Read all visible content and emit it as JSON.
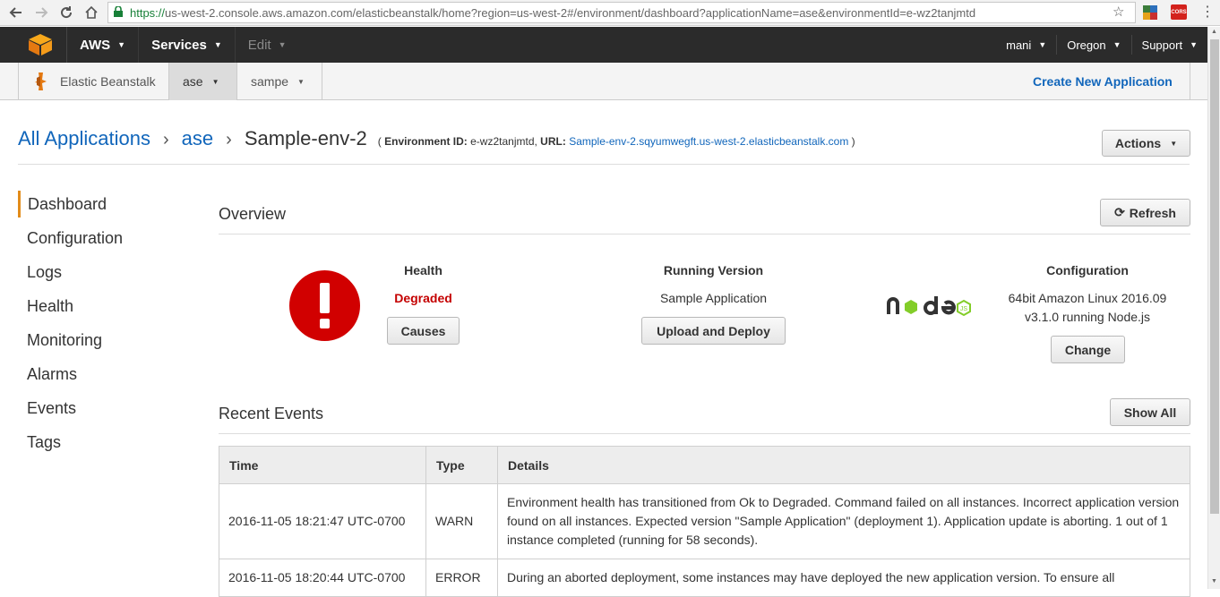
{
  "browser": {
    "url_scheme": "https://",
    "url_rest": "us-west-2.console.aws.amazon.com/elasticbeanstalk/home?region=us-west-2#/environment/dashboard?applicationName=ase&environmentId=e-wz2tanjmtd",
    "ext_label": "CORS"
  },
  "topnav": {
    "aws_label": "AWS",
    "services_label": "Services",
    "edit_label": "Edit",
    "user_label": "mani",
    "region_label": "Oregon",
    "support_label": "Support"
  },
  "subnav": {
    "brand": "Elastic Beanstalk",
    "tabs": [
      {
        "label": "ase",
        "active": true
      },
      {
        "label": "sampe",
        "active": false
      }
    ],
    "create_label": "Create New Application"
  },
  "breadcrumb": {
    "all_apps": "All Applications",
    "app": "ase",
    "env": "Sample-env-2",
    "open_paren": "(",
    "env_id_label": "Environment ID:",
    "env_id": "e-wz2tanjmtd,",
    "url_label": "URL:",
    "url": "Sample-env-2.sqyumwegft.us-west-2.elasticbeanstalk.com",
    "close_paren": ")"
  },
  "actions_label": "Actions",
  "sidebar": {
    "items": [
      "Dashboard",
      "Configuration",
      "Logs",
      "Health",
      "Monitoring",
      "Alarms",
      "Events",
      "Tags"
    ],
    "active": "Dashboard"
  },
  "overview": {
    "title": "Overview",
    "refresh_label": "Refresh",
    "health": {
      "title": "Health",
      "status": "Degraded",
      "button": "Causes"
    },
    "running_version": {
      "title": "Running Version",
      "value": "Sample Application",
      "button": "Upload and Deploy"
    },
    "configuration": {
      "title": "Configuration",
      "line1": "64bit Amazon Linux 2016.09",
      "line2": "v3.1.0 running Node.js",
      "button": "Change"
    }
  },
  "recent_events": {
    "title": "Recent Events",
    "show_all_label": "Show All",
    "columns": [
      "Time",
      "Type",
      "Details"
    ],
    "rows": [
      {
        "time": "2016-11-05 18:21:47 UTC-0700",
        "type": "WARN",
        "details": "Environment health has transitioned from Ok to Degraded. Command failed on all instances. Incorrect application version found on all instances. Expected version \"Sample Application\" (deployment 1). Application update is aborting. 1 out of 1 instance completed (running for 58 seconds)."
      },
      {
        "time": "2016-11-05 18:20:44 UTC-0700",
        "type": "ERROR",
        "details": "During an aborted deployment, some instances may have deployed the new application version. To ensure all"
      }
    ]
  },
  "colors": {
    "link": "#1166bb",
    "degraded": "#c40000",
    "warn": "#e8901c",
    "active_accent": "#e28c1a",
    "topnav_bg": "#2b2b2b"
  }
}
